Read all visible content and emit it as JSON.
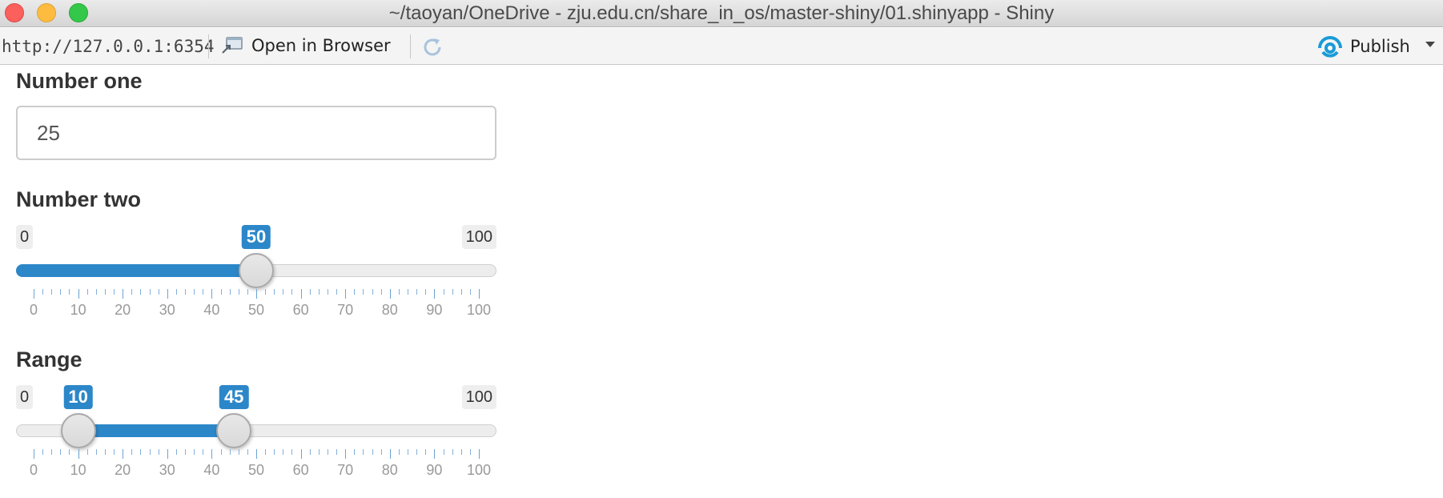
{
  "window": {
    "title": "~/taoyan/OneDrive - zju.edu.cn/share_in_os/master-shiny/01.shinyapp - Shiny"
  },
  "toolbar": {
    "url": "http://127.0.0.1:6354",
    "open_in_browser_label": "Open in Browser",
    "publish_label": "Publish"
  },
  "number_one": {
    "label": "Number one",
    "value": "25"
  },
  "number_two": {
    "label": "Number two",
    "min_label": "0",
    "max_label": "100",
    "min": 0,
    "max": 100,
    "value": 50,
    "value_label": "50",
    "tick_labels": [
      "0",
      "10",
      "20",
      "30",
      "40",
      "50",
      "60",
      "70",
      "80",
      "90",
      "100"
    ]
  },
  "range": {
    "label": "Range",
    "min_label": "0",
    "max_label": "100",
    "min": 0,
    "max": 100,
    "from": 10,
    "to": 45,
    "from_label": "10",
    "to_label": "45",
    "tick_labels": [
      "0",
      "10",
      "20",
      "30",
      "40",
      "50",
      "60",
      "70",
      "80",
      "90",
      "100"
    ]
  },
  "colors": {
    "accent": "#2c87c9",
    "publish_icon": "#1a9bd7"
  },
  "icons": {
    "open_in_browser": "open-in-browser-icon",
    "reload": "reload-icon",
    "publish": "publish-icon"
  }
}
